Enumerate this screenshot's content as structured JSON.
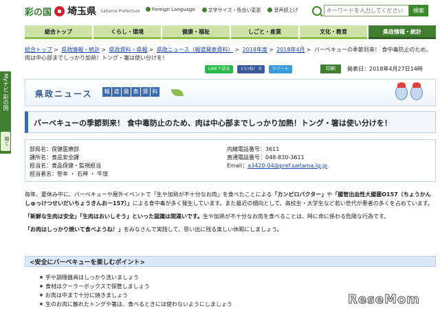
{
  "side_tab": {
    "label": "Myナビ 彩の国",
    "open_label": "開く"
  },
  "header": {
    "logo_sainokuni": "彩の国",
    "logo_saitama": "埼玉県",
    "logo_roman": "Saitama Prefecture",
    "util_links": [
      "Foreign Language",
      "文字サイズ・色合い変更",
      "音声読上げ"
    ],
    "search_placeholder": "キーワードを入力してください",
    "search_button": "検索"
  },
  "nav": {
    "items": [
      "総合トップ",
      "くらし・環境",
      "健康・福祉",
      "しごと・産業",
      "文化・教育",
      "県政情報・統計"
    ]
  },
  "breadcrumb": {
    "items": [
      "総合トップ",
      "県政情報・統計",
      "県政資料・県報",
      "県政ニュース（報道発表資料）",
      "2018年度",
      "2018年4月"
    ],
    "current": "バーベキューの季節到来！ 食中毒防止のため、肉は中心部までしっかり加熱！トング・箸は使い分けを！"
  },
  "share": {
    "line": "LINEで送る",
    "facebook": "いいね！ 0",
    "twitter": "ツイート"
  },
  "print_label": "印刷",
  "publish_date": "発表日：2018年4月27日14時",
  "banner": {
    "title": "県政ニュース",
    "pill": [
      "報",
      "道",
      "発",
      "表",
      "資",
      "料"
    ]
  },
  "article_title": "バーベキューの季節到来！ 食中毒防止のため、肉は中心部までしっかり加熱！トング・箸は使い分けを！",
  "contact": {
    "department": "部局名：保健医療部",
    "section": "課所名：食品安全課",
    "person": "担当名：食品保健・監視担当",
    "staff": "担当者名：笹本 ・ 石神 ・ 牛窪",
    "ext": "内線電話番号：3611",
    "direct": "直通電話番号：048-830-3611",
    "email_label": "Email：",
    "email": "a3420-04@pref.saitama.lg.jp"
  },
  "body": {
    "p1a": "毎年、夏休み中に、バーベキューや屋外イベントで「生や加熱が不十分なお肉」を食べたことによる",
    "p1b": "「カンピロバクター」",
    "p1c": "や",
    "p1d": "「腸管出血性大腸菌O157（ちょうかんしゅっけつせいだいちょうきんおー157）」",
    "p1e": "による食中毒が多く発生しています。また最近の傾向として、高校生・大学生など若い世代が患者の多くを占めています。",
    "p2a": "「新鮮な生肉は安全」「生肉はおいしそう」といった認識は間違いです。",
    "p2b": "生や加熱が不十分なお肉を食べることは、時に命に係わる危険な行為です。",
    "p3a": "「お肉はしっかり焼いて食べようね！」",
    "p3b": "をみなさんで実践して、思い出に残る楽しい休暇にしましょう。"
  },
  "points": {
    "heading": "<安全にバーベキューを楽しむポイント>",
    "items": [
      "手や調理器具はしっかり洗いましょう",
      "食材はクーラーボックスで保管しましょう",
      "お肉は中まで十分に焼きましょう",
      "生のお肉に触れたトングや箸は、食べるときには使わないようにしましょう"
    ]
  },
  "watermark": "ReseMom"
}
